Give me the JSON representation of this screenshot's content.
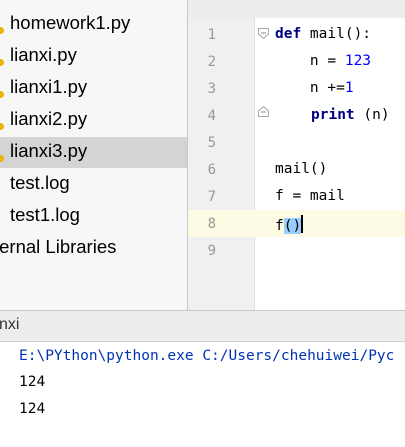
{
  "project": {
    "files": [
      {
        "name": "homework1.py",
        "selected": false,
        "dot_color": "#e6b800"
      },
      {
        "name": "lianxi.py",
        "selected": false,
        "dot_color": "#e6b800"
      },
      {
        "name": "lianxi1.py",
        "selected": false,
        "dot_color": "#e6b800"
      },
      {
        "name": "lianxi2.py",
        "selected": false,
        "dot_color": "#e6b800"
      },
      {
        "name": "lianxi3.py",
        "selected": true,
        "dot_color": "#e6b800"
      },
      {
        "name": "test.log",
        "selected": false
      },
      {
        "name": "test1.log",
        "selected": false
      }
    ],
    "external_libraries": "ternal Libraries"
  },
  "editor": {
    "line_numbers": [
      "1",
      "2",
      "3",
      "4",
      "5",
      "6",
      "7",
      "8",
      "9"
    ],
    "current_line": 8,
    "code": {
      "l1_kw": "def",
      "l1_rest": " mail():",
      "l2_pre": "    n = ",
      "l2_num": "123",
      "l3_pre": "    n +=",
      "l3_num": "1",
      "l4_kw": "print",
      "l4_rest": " (n)",
      "l6": "mail()",
      "l7": "f = mail",
      "l8_name": "f",
      "l8_parens": "()"
    }
  },
  "run": {
    "title": "nxi",
    "command": "E:\\PYthon\\python.exe C:/Users/chehuiwei/Pyc",
    "output": [
      "124",
      "124"
    ]
  },
  "colors": {
    "keyword": "#000080",
    "number": "#0000ff",
    "selected_row": "#d4d4d4",
    "current_line": "#fdfbe3",
    "console_command": "#0033b3",
    "python_file_dot": "#e6b800"
  }
}
